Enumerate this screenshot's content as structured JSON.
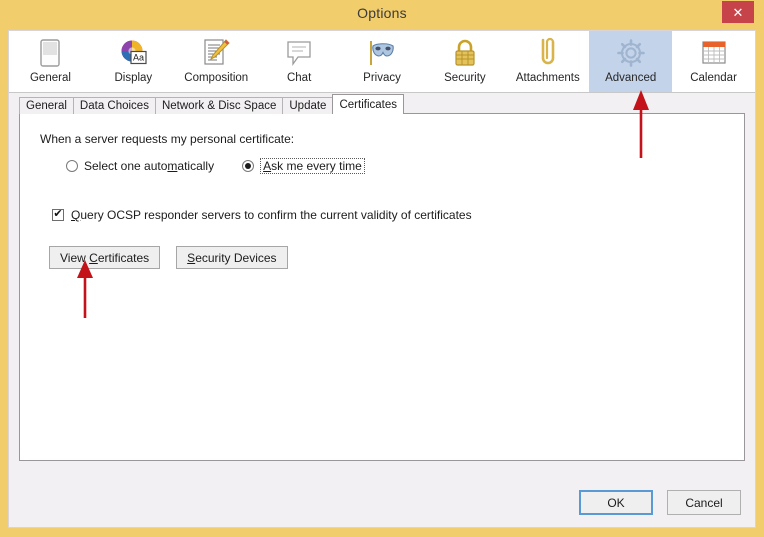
{
  "window": {
    "title": "Options",
    "close_label": "✕",
    "close_icon": "close-icon",
    "titlebar_color": "#f2cd6b",
    "accent_color": "#c7434a"
  },
  "toolbar": {
    "selected": "Advanced",
    "items": [
      {
        "label": "General",
        "icon": "general-icon"
      },
      {
        "label": "Display",
        "icon": "display-icon"
      },
      {
        "label": "Composition",
        "icon": "composition-icon"
      },
      {
        "label": "Chat",
        "icon": "chat-icon"
      },
      {
        "label": "Privacy",
        "icon": "privacy-mask-icon"
      },
      {
        "label": "Security",
        "icon": "security-lock-icon"
      },
      {
        "label": "Attachments",
        "icon": "attachments-paperclip-icon"
      },
      {
        "label": "Advanced",
        "icon": "advanced-gear-icon"
      },
      {
        "label": "Calendar",
        "icon": "calendar-icon"
      }
    ]
  },
  "tabs": {
    "active": "Certificates",
    "items": [
      {
        "label": "General"
      },
      {
        "label": "Data Choices"
      },
      {
        "label": "Network & Disc Space"
      },
      {
        "label": "Update"
      },
      {
        "label": "Certificates"
      }
    ]
  },
  "panel": {
    "prompt": "When a server requests my personal certificate:",
    "radios": [
      {
        "label": "Select one automatically",
        "checked": false,
        "accel": "m",
        "focused": false
      },
      {
        "label": "Ask me every time",
        "checked": true,
        "accel": "A",
        "focused": true
      }
    ],
    "checkbox": {
      "label": "Query OCSP responder servers to confirm the current validity of certificates",
      "checked": true,
      "check_glyph": "✔",
      "accel": "Q"
    },
    "buttons": [
      {
        "label": "View Certificates",
        "accel": "C"
      },
      {
        "label": "Security Devices",
        "accel": "S"
      }
    ]
  },
  "footer": {
    "ok_label": "OK",
    "cancel_label": "Cancel",
    "default_button": "OK",
    "default_border_color": "#5a9ad4"
  },
  "annotations": {
    "arrow_color": "#c4121a",
    "arrows": [
      {
        "name": "arrow-pointing-advanced-tab",
        "target": "Advanced"
      },
      {
        "name": "arrow-pointing-view-certificates",
        "target": "View Certificates"
      }
    ]
  }
}
